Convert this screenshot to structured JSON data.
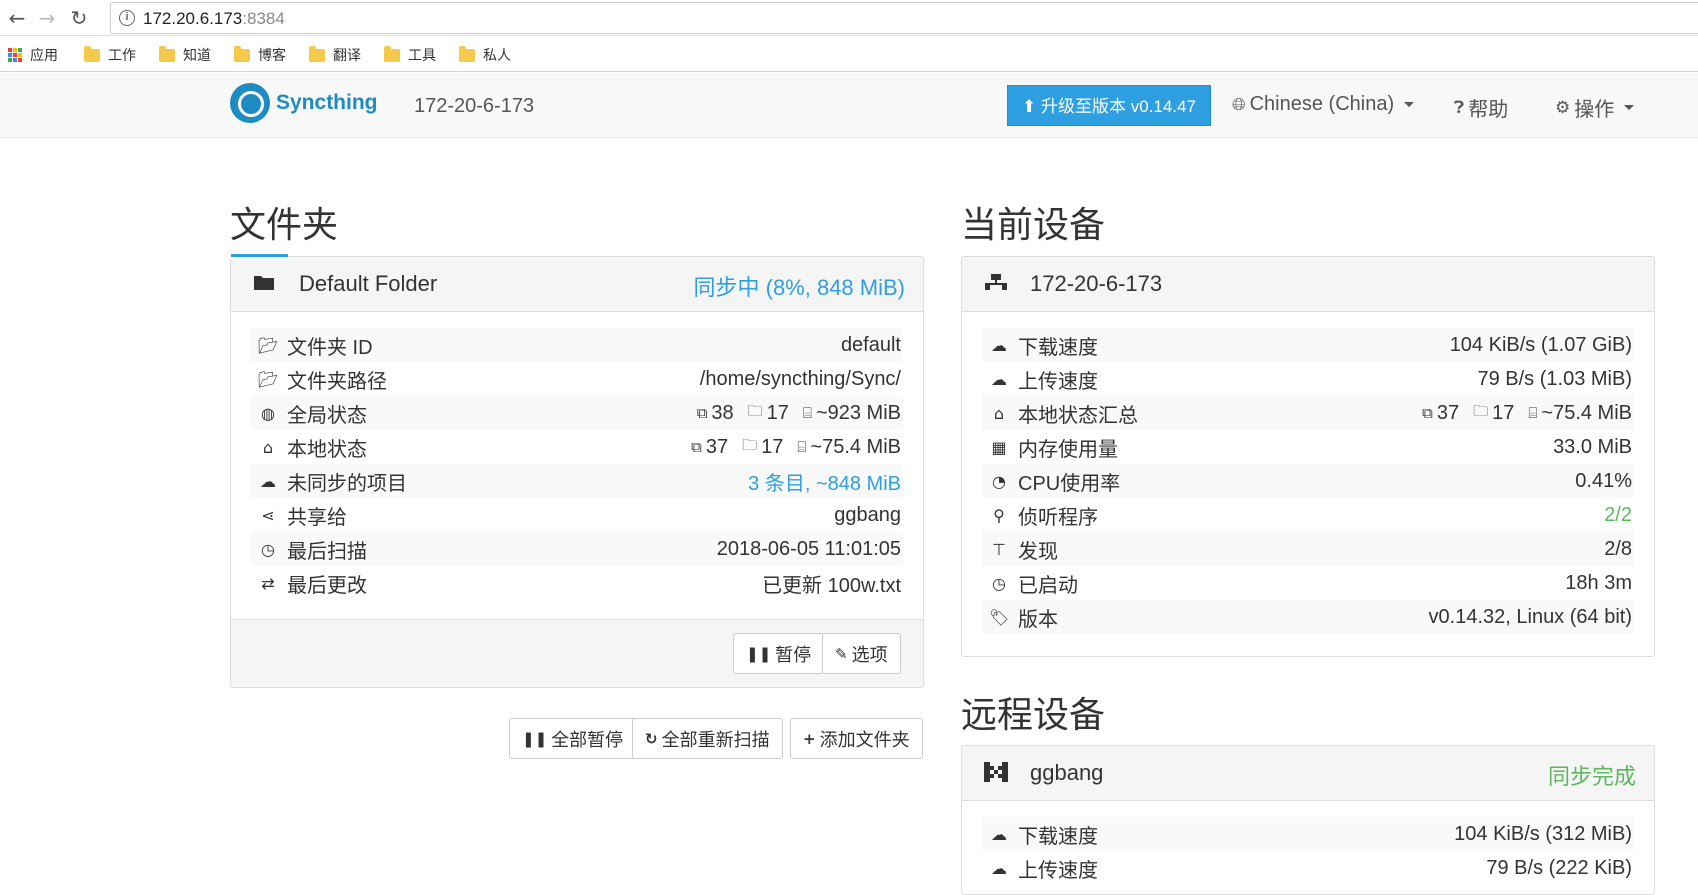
{
  "browser": {
    "url_host": "172.20.6.173",
    "url_port": ":8384",
    "bookmarks": [
      "应用",
      "工作",
      "知道",
      "博客",
      "翻译",
      "工具",
      "私人"
    ]
  },
  "navbar": {
    "logo_text": "Syncthing",
    "hostname": "172-20-6-173",
    "upgrade_label": "升级至版本 v0.14.47",
    "language": "Chinese (China)",
    "help": "帮助",
    "actions": "操作"
  },
  "folders": {
    "title": "文件夹",
    "folder": {
      "name": "Default Folder",
      "status": "同步中 (8%, 848 MiB)",
      "rows": [
        {
          "label": "文件夹 ID",
          "value": "default"
        },
        {
          "label": "文件夹路径",
          "value": "/home/syncthing/Sync/"
        },
        {
          "label": "全局状态",
          "files": "38",
          "dirs": "17",
          "size": "~923 MiB"
        },
        {
          "label": "本地状态",
          "files": "37",
          "dirs": "17",
          "size": "~75.4 MiB"
        },
        {
          "label": "未同步的项目",
          "value": "3 条目, ~848 MiB"
        },
        {
          "label": "共享给",
          "value": "ggbang"
        },
        {
          "label": "最后扫描",
          "value": "2018-06-05 11:01:05"
        },
        {
          "label": "最后更改",
          "value": "已更新 100w.txt"
        }
      ],
      "pause_label": "暂停",
      "options_label": "选项"
    },
    "pause_all_label": "全部暂停",
    "rescan_all_label": "全部重新扫描",
    "add_folder_label": "添加文件夹"
  },
  "this_device": {
    "title": "当前设备",
    "name": "172-20-6-173",
    "rows": [
      {
        "label": "下载速度",
        "value": "104 KiB/s (1.07 GiB)"
      },
      {
        "label": "上传速度",
        "value": "79 B/s (1.03 MiB)"
      },
      {
        "label": "本地状态汇总",
        "files": "37",
        "dirs": "17",
        "size": "~75.4 MiB"
      },
      {
        "label": "内存使用量",
        "value": "33.0 MiB"
      },
      {
        "label": "CPU使用率",
        "value": "0.41%"
      },
      {
        "label": "侦听程序",
        "value": "2/2"
      },
      {
        "label": "发现",
        "value": "2/8"
      },
      {
        "label": "已启动",
        "value": "18h 3m"
      },
      {
        "label": "版本",
        "value": "v0.14.32, Linux (64 bit)"
      }
    ]
  },
  "remote_devices": {
    "title": "远程设备",
    "device": {
      "name": "ggbang",
      "status": "同步完成",
      "rows": [
        {
          "label": "下载速度",
          "value": "104 KiB/s (312 MiB)"
        },
        {
          "label": "上传速度",
          "value": "79 B/s (222 KiB)"
        }
      ]
    }
  },
  "colors": {
    "accent": "#2e9fe0",
    "success": "#5cb85c"
  },
  "icons": {
    "bookmark_apps": "apps-grid-icon",
    "bookmark_folder": "folder-icon",
    "folder_panel": "folder-icon",
    "device_panel": "server-icon",
    "remote_device": "identicon-icon"
  }
}
